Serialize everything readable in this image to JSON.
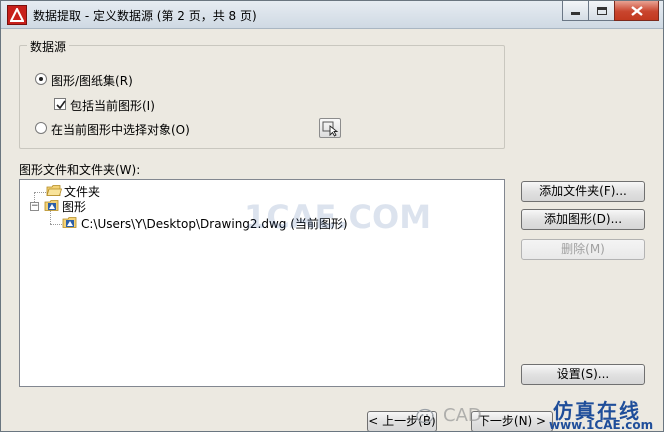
{
  "window": {
    "title": "数据提取 - 定义数据源 (第 2 页，共 8 页)"
  },
  "data_source": {
    "group_label": "数据源",
    "option_sheet_set": "图形/图纸集(R)",
    "option_include_current": "包括当前图形(I)",
    "option_select_objects": "在当前图形中选择对象(O)",
    "sheet_set_selected": true,
    "include_current_checked": true
  },
  "files": {
    "label": "图形文件和文件夹(W):",
    "tree": [
      {
        "label": "文件夹",
        "icon": "folder-icon"
      },
      {
        "label": "图形",
        "icon": "drawing-folder-icon",
        "expanded": true
      },
      {
        "label": "C:\\Users\\Y\\Desktop\\Drawing2.dwg (当前图形)",
        "icon": "drawing-file-icon"
      }
    ]
  },
  "side_buttons": {
    "add_folder": "添加文件夹(F)...",
    "add_drawing": "添加图形(D)...",
    "remove": "删除(M)",
    "settings": "设置(S)..."
  },
  "nav_buttons": {
    "back": "< 上一步(B)",
    "next": "下一步(N) >"
  },
  "watermark": {
    "center": "1CAE.COM",
    "bottom_left": "CAD",
    "bottom_right_cn": "仿真在线",
    "bottom_right_url": "www.1CAE.com"
  },
  "colors": {
    "accent_red": "#c8201b",
    "watermark_blue": "#1f4e9a"
  }
}
